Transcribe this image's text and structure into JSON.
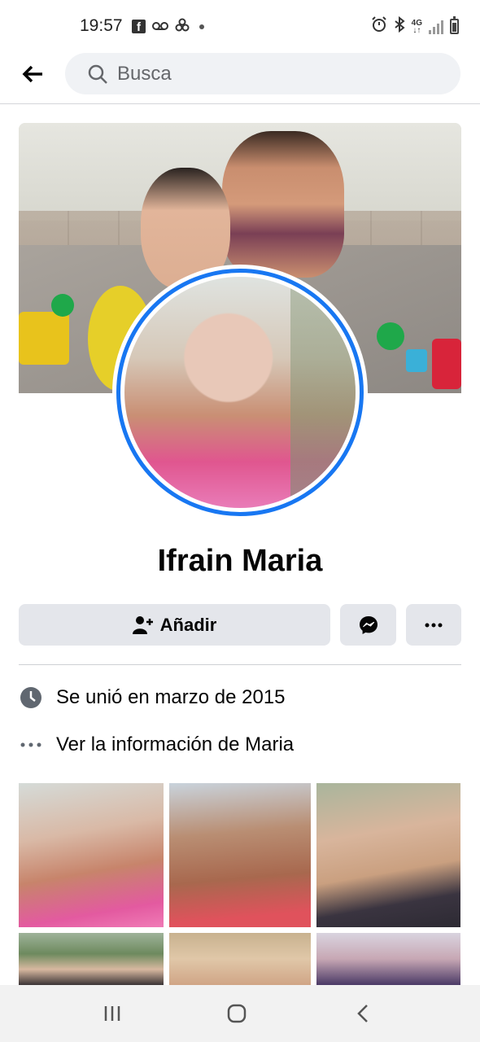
{
  "status_bar": {
    "time": "19:57",
    "left_icons": [
      "facebook-icon",
      "voicemail-icon",
      "app-icon",
      "notification-dot"
    ],
    "network": "4G",
    "right_icons": [
      "alarm-icon",
      "bluetooth-icon",
      "network-4g-icon",
      "signal-icon",
      "battery-icon"
    ]
  },
  "header": {
    "search_placeholder": "Busca"
  },
  "profile": {
    "name": "Ifrain Maria",
    "avatar_ring_color": "#1877f2"
  },
  "actions": {
    "add_label": "Añadir"
  },
  "intro": {
    "joined": "Se unió en marzo de 2015",
    "about": "Ver la información de Maria"
  },
  "photos": {
    "count_visible": 6
  },
  "colors": {
    "accent": "#1877f2",
    "button_bg": "#e4e6eb",
    "search_bg": "#f0f2f5"
  }
}
